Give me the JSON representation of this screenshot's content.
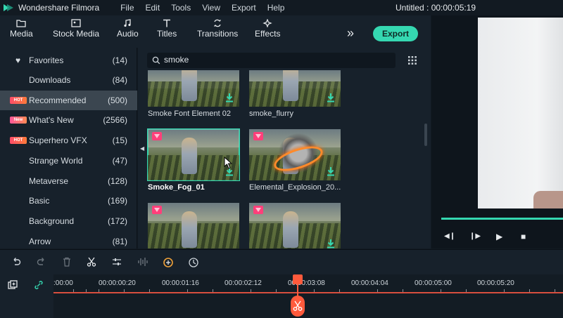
{
  "app": {
    "name": "Wondershare Filmora",
    "doc_title": "Untitled : 00:00:05:19"
  },
  "menu": [
    "File",
    "Edit",
    "Tools",
    "View",
    "Export",
    "Help"
  ],
  "toolbar": {
    "media": "Media",
    "stock_media": "Stock Media",
    "audio": "Audio",
    "titles": "Titles",
    "transitions": "Transitions",
    "effects": "Effects",
    "export": "Export"
  },
  "sidebar": [
    {
      "label": "Favorites",
      "count": "(14)"
    },
    {
      "label": "Downloads",
      "count": "(84)"
    },
    {
      "label": "Recommended",
      "count": "(500)",
      "tag": "HOT"
    },
    {
      "label": "What's New",
      "count": "(2566)",
      "tag": "New"
    },
    {
      "label": "Superhero VFX",
      "count": "(15)",
      "tag": "HOT"
    },
    {
      "label": "Strange World",
      "count": "(47)"
    },
    {
      "label": "Metaverse",
      "count": "(128)"
    },
    {
      "label": "Basic",
      "count": "(169)"
    },
    {
      "label": "Background",
      "count": "(172)"
    },
    {
      "label": "Arrow",
      "count": "(81)"
    }
  ],
  "search": {
    "value": "smoke"
  },
  "assets": [
    {
      "title": "Smoke Font Element 02"
    },
    {
      "title": "smoke_flurry"
    },
    {
      "title": "Smoke_Fog_01"
    },
    {
      "title": "Elemental_Explosion_20..."
    },
    {
      "title": ""
    },
    {
      "title": ""
    }
  ],
  "timeline": {
    "ticks": [
      ":00:00",
      "00:00:00:20",
      "00:00:01:16",
      "00:00:02:12",
      "00:00:03:08",
      "00:00:04:04",
      "00:00:05:00",
      "00:00:05:20"
    ]
  },
  "colors": {
    "accent": "#35d8b1",
    "playhead": "#ff5a3c",
    "background": "#17212b"
  }
}
